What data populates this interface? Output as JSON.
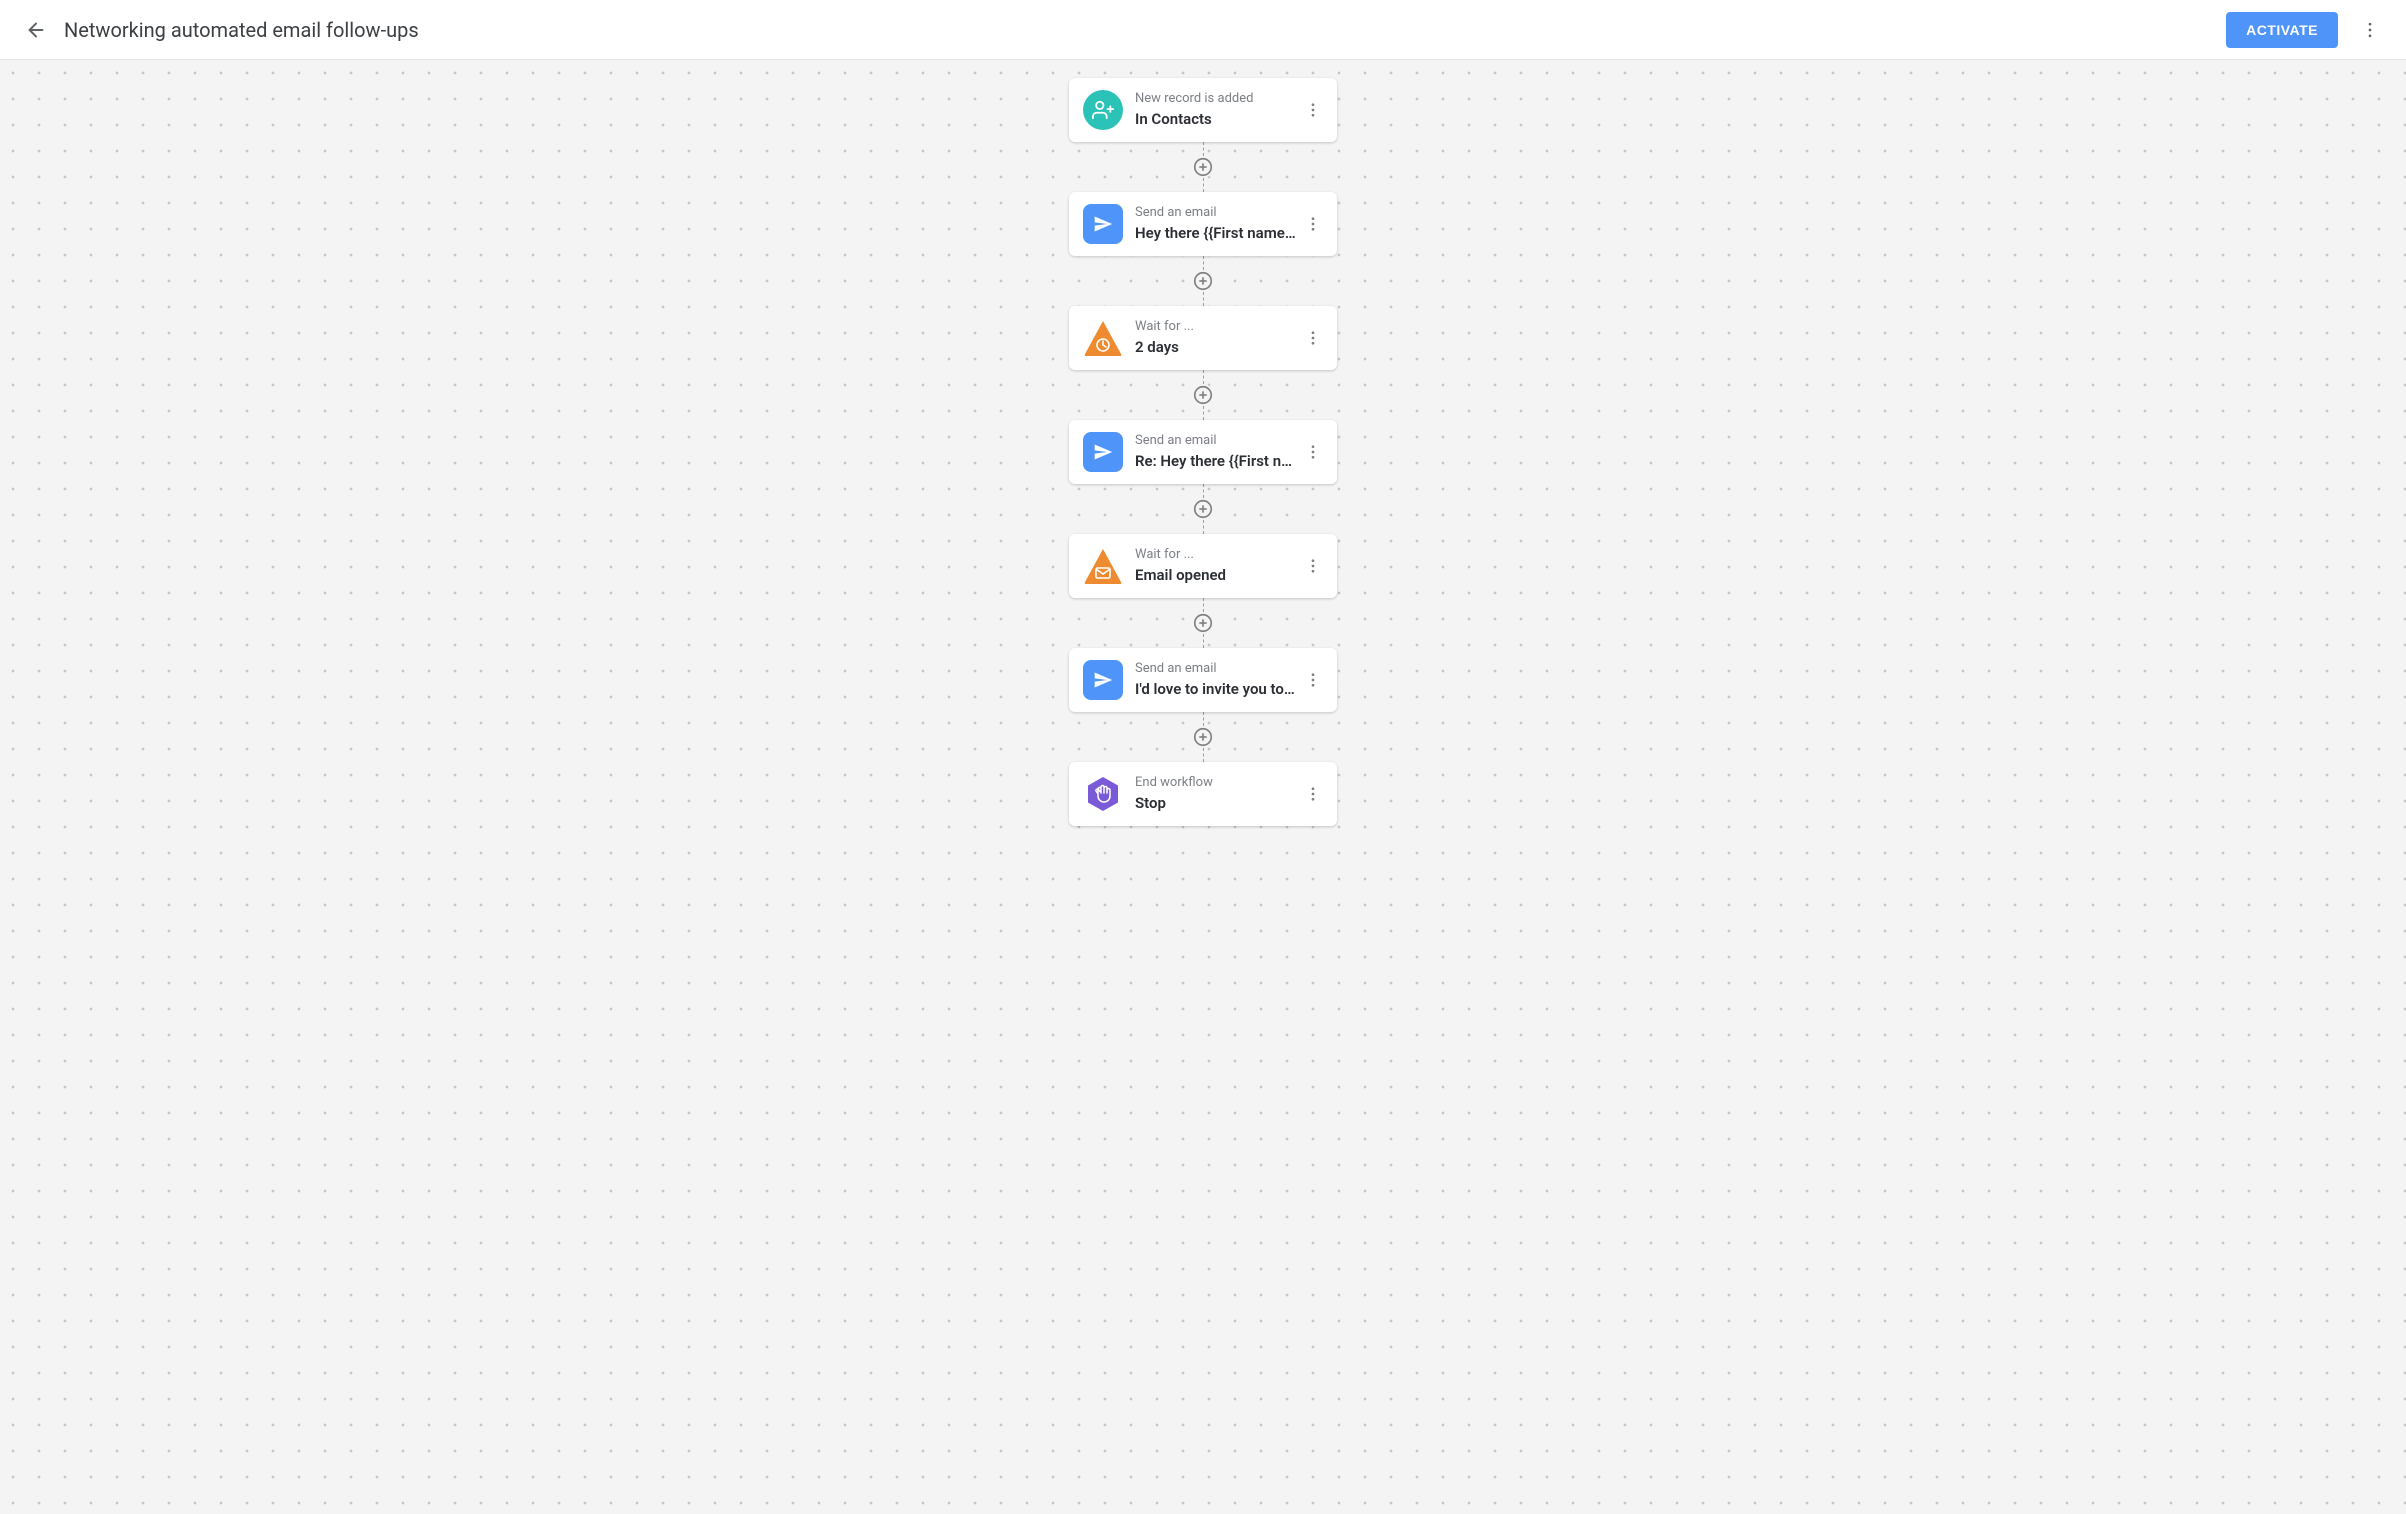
{
  "header": {
    "title": "Networking automated email follow-ups",
    "activate_label": "ACTIVATE"
  },
  "nodes": [
    {
      "icon": "person-add",
      "icon_shape": "circle",
      "icon_color": "teal",
      "step": "New record is added",
      "desc": "In Contacts"
    },
    {
      "icon": "send",
      "icon_shape": "square",
      "icon_color": "blue",
      "step": "Send an email",
      "desc": "Hey there {{First name…"
    },
    {
      "icon": "clock-triangle",
      "icon_shape": "triangle",
      "icon_color": "orange",
      "step": "Wait for ...",
      "desc": "2 days"
    },
    {
      "icon": "send",
      "icon_shape": "square",
      "icon_color": "blue",
      "step": "Send an email",
      "desc": "Re: Hey there {{First n…"
    },
    {
      "icon": "mail-triangle",
      "icon_shape": "triangle",
      "icon_color": "orange",
      "step": "Wait for ...",
      "desc": "Email opened"
    },
    {
      "icon": "send",
      "icon_shape": "square",
      "icon_color": "blue",
      "step": "Send an email",
      "desc": "I'd love to invite you to…"
    },
    {
      "icon": "hand-hex",
      "icon_shape": "hex",
      "icon_color": "purple",
      "step": "End workflow",
      "desc": "Stop"
    }
  ]
}
